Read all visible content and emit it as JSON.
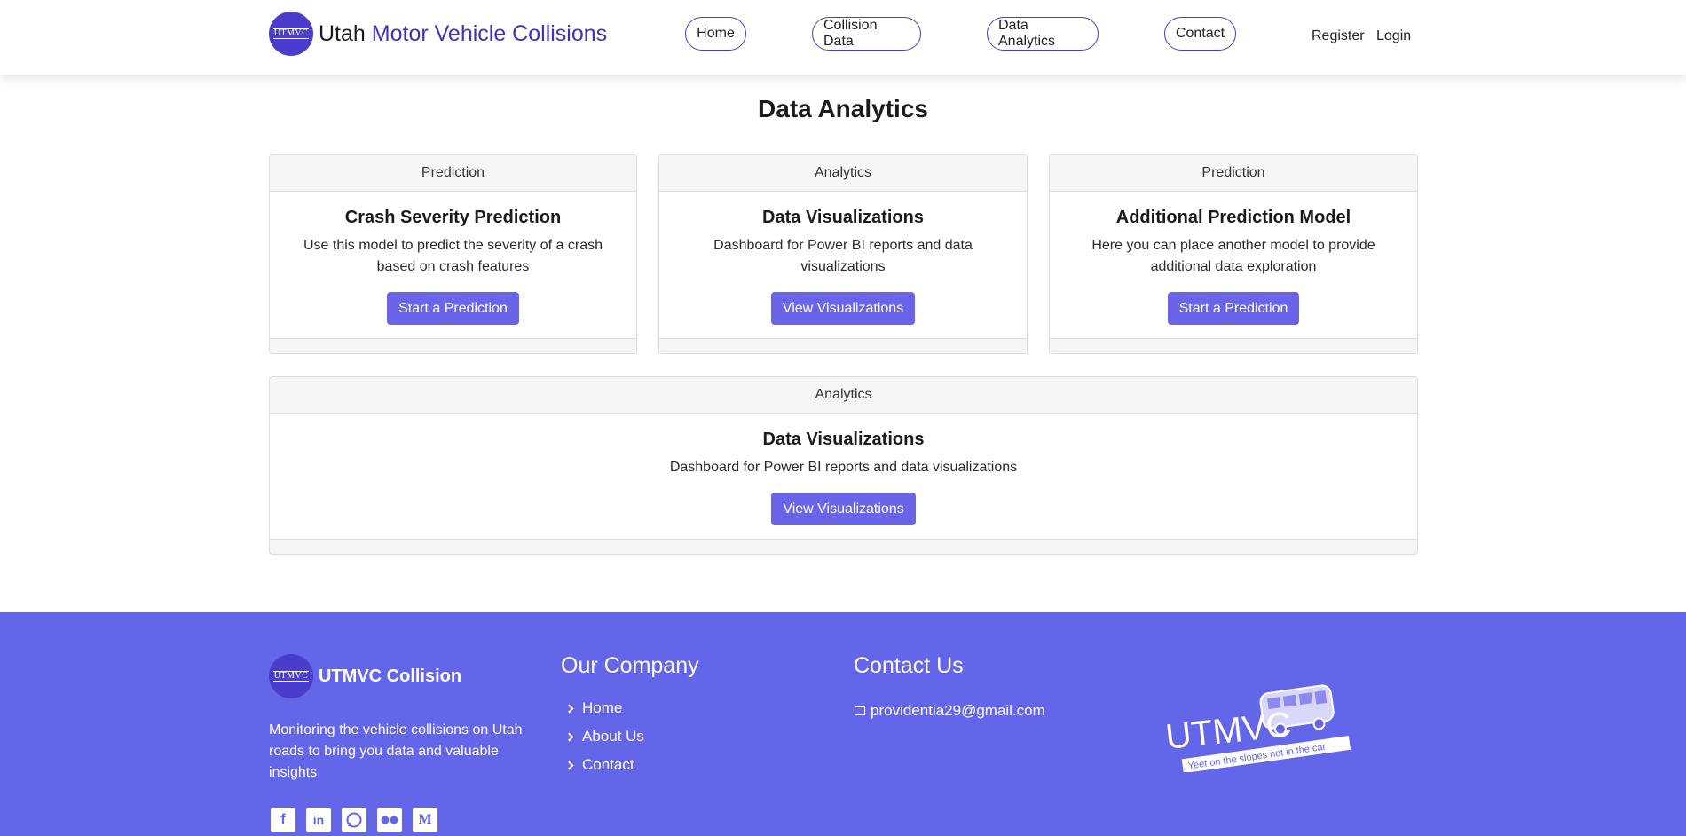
{
  "header": {
    "logo_text": "UTMVC",
    "brand_part1": "Utah",
    "brand_part2": "Motor Vehicle Collisions",
    "nav": [
      "Home",
      "Collision Data",
      "Data Analytics",
      "Contact"
    ],
    "register": "Register",
    "login": "Login"
  },
  "main": {
    "title": "Data Analytics",
    "cards": [
      {
        "category": "Prediction",
        "title": "Crash Severity Prediction",
        "text": "Use this model to predict the severity of a crash based on crash features",
        "button": "Start a Prediction"
      },
      {
        "category": "Analytics",
        "title": "Data Visualizations",
        "text": "Dashboard for Power BI reports and data visualizations",
        "button": "View Visualizations"
      },
      {
        "category": "Prediction",
        "title": "Additional Prediction Model",
        "text": "Here you can place another model to provide additional data exploration",
        "button": "Start a Prediction"
      },
      {
        "category": "Analytics",
        "title": "Data Visualizations",
        "text": "Dashboard for Power BI reports and data visualizations",
        "button": "View Visualizations"
      }
    ]
  },
  "footer": {
    "logo_text": "UTMVC",
    "brand": "UTMVC Collision",
    "description": "Monitoring the vehicle collisions on Utah roads to bring you data and valuable insights",
    "company_heading": "Our Company",
    "company_links": [
      "Home",
      "About Us",
      "Contact"
    ],
    "contact_heading": "Contact Us",
    "email": "providentia29@gmail.com",
    "art_title": "UTMVC",
    "art_tagline": "Yeet on the slopes not in the car",
    "socials": [
      "facebook-icon",
      "linkedin-icon",
      "whatsapp-icon",
      "flickr-icon",
      "medium-icon"
    ]
  },
  "colors": {
    "brand": "#4a3ccc",
    "footer_bg": "#6466ea",
    "button": "#6a64e8"
  }
}
